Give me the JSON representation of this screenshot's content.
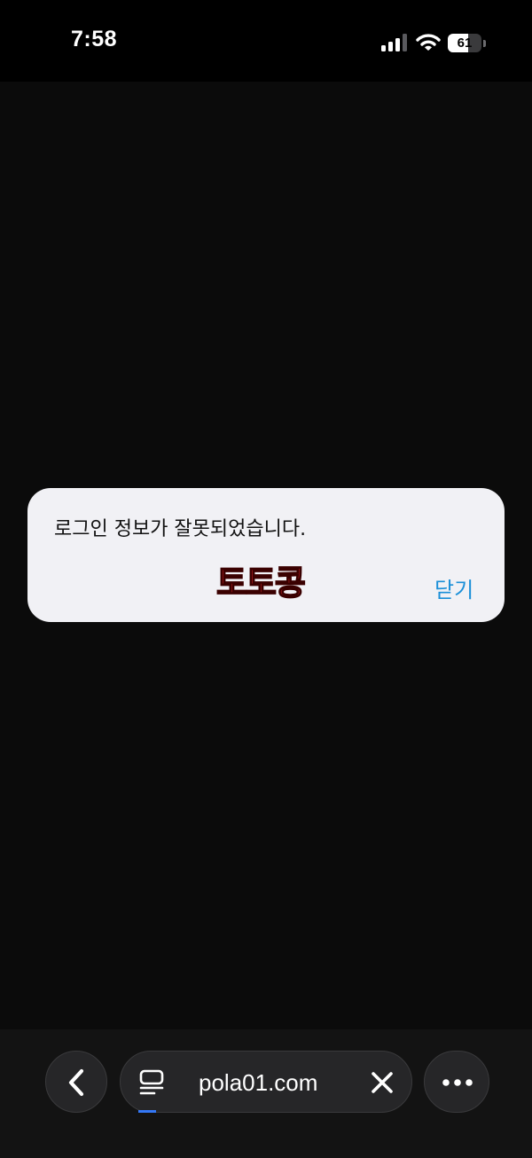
{
  "status_bar": {
    "time": "7:58",
    "battery_level": "61",
    "battery_fraction": 0.61,
    "icons": [
      "signal-icon",
      "wifi-icon",
      "battery-icon"
    ]
  },
  "alert": {
    "message": "로그인 정보가 잘못되었습니다.",
    "watermark": "토토콩",
    "close_label": "닫기",
    "accent_color": "#1a8fd8"
  },
  "toolbar": {
    "address": "pola01.com",
    "load_progress": 0.07,
    "icons": [
      "back-chevron-icon",
      "tabs-icon",
      "clear-icon",
      "more-icon"
    ]
  }
}
